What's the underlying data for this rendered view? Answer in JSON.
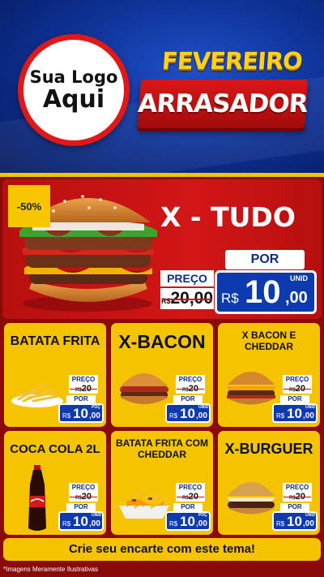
{
  "header": {
    "logo_line1": "Sua Logo",
    "logo_line2": "Aqui",
    "title_line1": "FEVEREIRO",
    "title_line2": "ARRASADOR"
  },
  "featured": {
    "discount": "-50%",
    "name": "X - TUDO",
    "preco_label": "PREÇO",
    "currency_small": "R$",
    "old_price": "20,00",
    "por_label": "POR",
    "currency": "R$",
    "price_int": "10",
    "price_dec": ",00",
    "unit": "UNID"
  },
  "price_text": {
    "preco_label": "PREÇO",
    "currency_small": "R$",
    "old_price": "20",
    "por_label": "POR",
    "currency": "R$",
    "price_int": "10",
    "price_dec": ",00"
  },
  "products": [
    {
      "name": "BATATA FRITA",
      "unit": "POÇ"
    },
    {
      "name": "X-BACON",
      "unit": "UNID"
    },
    {
      "name": "X BACON E CHEDDAR",
      "unit": "UNID"
    },
    {
      "name": "COCA COLA 2L",
      "unit": "UNID"
    },
    {
      "name": "BATATA FRITA COM CHEDDAR",
      "unit": "POÇ"
    },
    {
      "name": "X-BURGUER",
      "unit": "UNID"
    }
  ],
  "cta": "Crie seu encarte com este tema!",
  "note": "*Imagens Meramente Ilustrativas"
}
